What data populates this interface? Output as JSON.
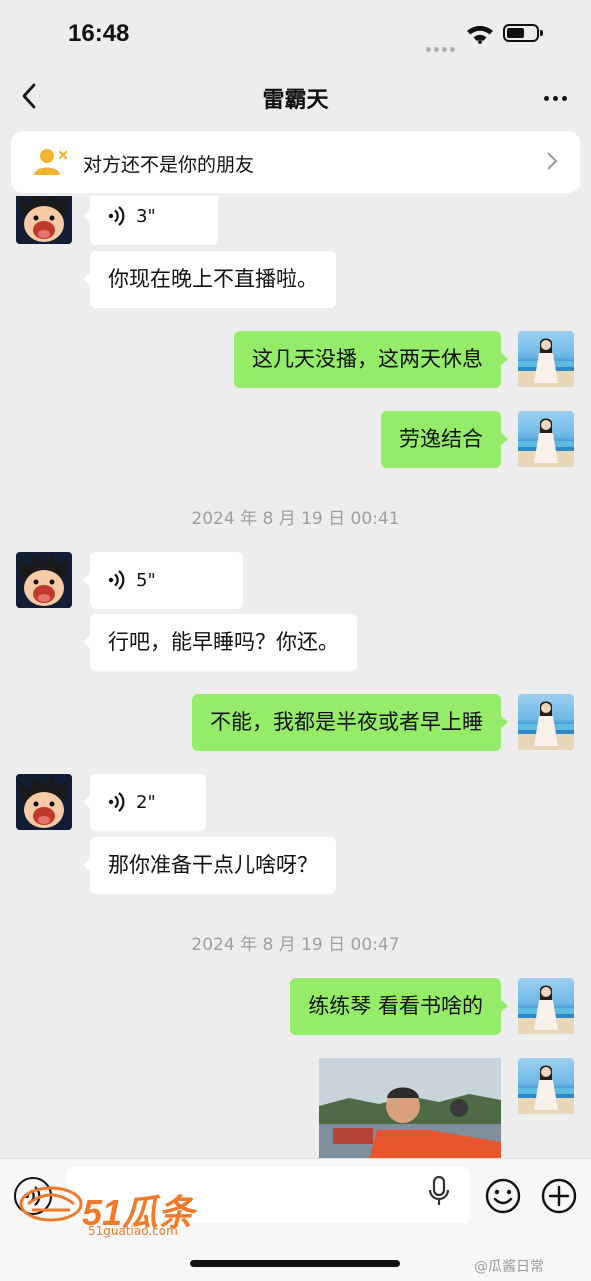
{
  "status_bar": {
    "time": "16:48",
    "battery_level": 0.6
  },
  "header": {
    "title": "雷霸天"
  },
  "banner": {
    "text": "对方还不是你的朋友"
  },
  "chat": {
    "voice_1": "3\"",
    "msg_1": "你现在晚上不直播啦。",
    "msg_2": "这几天没播，这两天休息",
    "msg_3": "劳逸结合",
    "timestamp_1": "2024 年 8 月 19 日 00:41",
    "voice_2": "5\"",
    "msg_4": "行吧，能早睡吗？你还。",
    "msg_5": "不能，我都是半夜或者早上睡",
    "voice_3": "2\"",
    "msg_6": "那你准备干点儿啥呀？",
    "timestamp_2": "2024 年 8 月 19 日 00:47",
    "msg_7": "练练琴 看看书啥的"
  },
  "watermarks": {
    "logo_big": "51瓜条",
    "logo_small": "51guatiao.com",
    "corner": "@瓜酱日常"
  },
  "colors": {
    "background": "#ededed",
    "outgoing_bubble": "#95ec69",
    "incoming_bubble": "#ffffff",
    "logo": "#f07a2a"
  },
  "icons": [
    "back-arrow-icon",
    "more-icon",
    "user-warning-icon",
    "chevron-right-icon",
    "voice-wave-icon",
    "microphone-icon",
    "emoji-icon",
    "plus-icon"
  ]
}
